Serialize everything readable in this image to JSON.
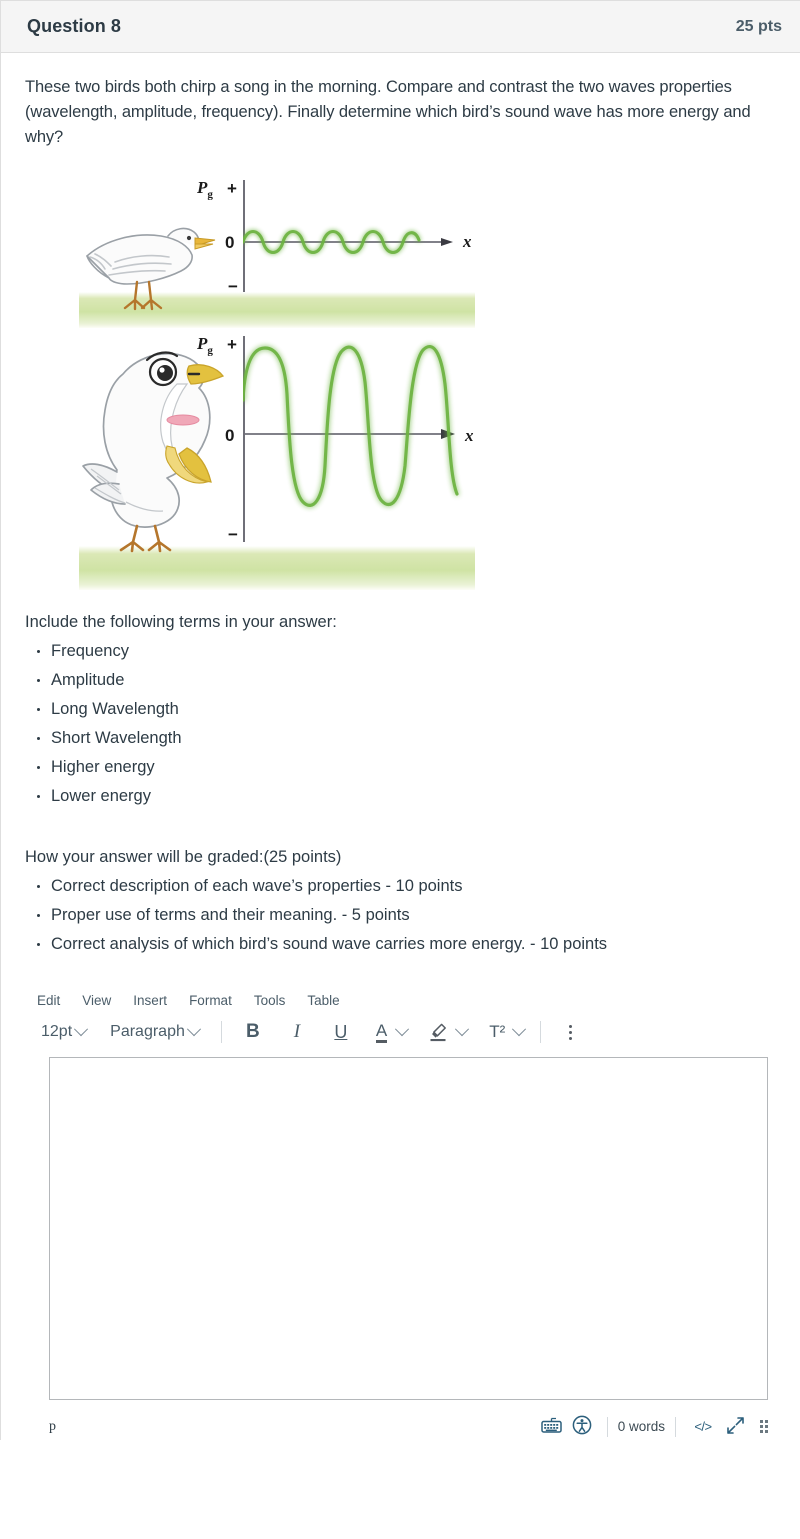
{
  "header": {
    "title": "Question 8",
    "points": "25 pts"
  },
  "prompt": "These two birds both chirp a song in the morning.  Compare and contrast the two waves properties (wavelength, amplitude, frequency). Finally determine which bird’s sound wave has more energy and why?",
  "figure": {
    "alt": "Two birds chirping with pressure versus position wave graphs",
    "panels": [
      {
        "bird": "small-bird-closed-beak",
        "y_axis_label": "P",
        "y_axis_sub": "g",
        "plus_sign": "+",
        "minus_sign": "−",
        "zero_label": "0",
        "x_axis_label": "x",
        "wave": {
          "cycles": 4,
          "amplitude": "small",
          "wavelength": "long-relative",
          "color": "#6cb33f"
        }
      },
      {
        "bird": "large-bird-open-beak",
        "y_axis_label": "P",
        "y_axis_sub": "g",
        "plus_sign": "+",
        "minus_sign": "−",
        "zero_label": "0",
        "x_axis_label": "x",
        "wave": {
          "cycles": 3,
          "amplitude": "large",
          "wavelength": "short-relative",
          "color": "#6cb33f"
        }
      }
    ]
  },
  "terms": {
    "intro": "Include the following terms in your answer:",
    "items": [
      "Frequency",
      "Amplitude",
      "Long Wavelength",
      "Short Wavelength",
      "Higher energy",
      "Lower energy"
    ]
  },
  "grading": {
    "intro": "How your answer will be graded:(25 points)",
    "items": [
      "Correct description of each wave’s properties - 10 points",
      "Proper use of terms and their meaning. - 5 points",
      "Correct analysis of which bird’s sound wave carries more energy. - 10 points"
    ]
  },
  "editor": {
    "menubar": [
      "Edit",
      "View",
      "Insert",
      "Format",
      "Tools",
      "Table"
    ],
    "toolbar": {
      "font_size": "12pt",
      "block_format": "Paragraph",
      "bold": "B",
      "italic": "I",
      "underline": "U",
      "text_color": "A",
      "highlight": "highlighter-icon",
      "superscript": "T²",
      "more": "more-options-icon"
    },
    "content": "",
    "placeholder": "",
    "statusbar": {
      "path": "p",
      "keyboard": "keyboard-icon",
      "accessibility": "accessibility-checker-icon",
      "word_count": "0 words",
      "source_code": "</>",
      "resize": "resize-icon",
      "drag": "drag-handle-icon"
    }
  },
  "colors": {
    "header_bg": "#f5f5f5",
    "border": "#dedede",
    "text": "#2d3b45",
    "wave_green": "#6cb33f",
    "ground_green": "#cfe3a4",
    "icon_blue": "#2c5f7c"
  }
}
